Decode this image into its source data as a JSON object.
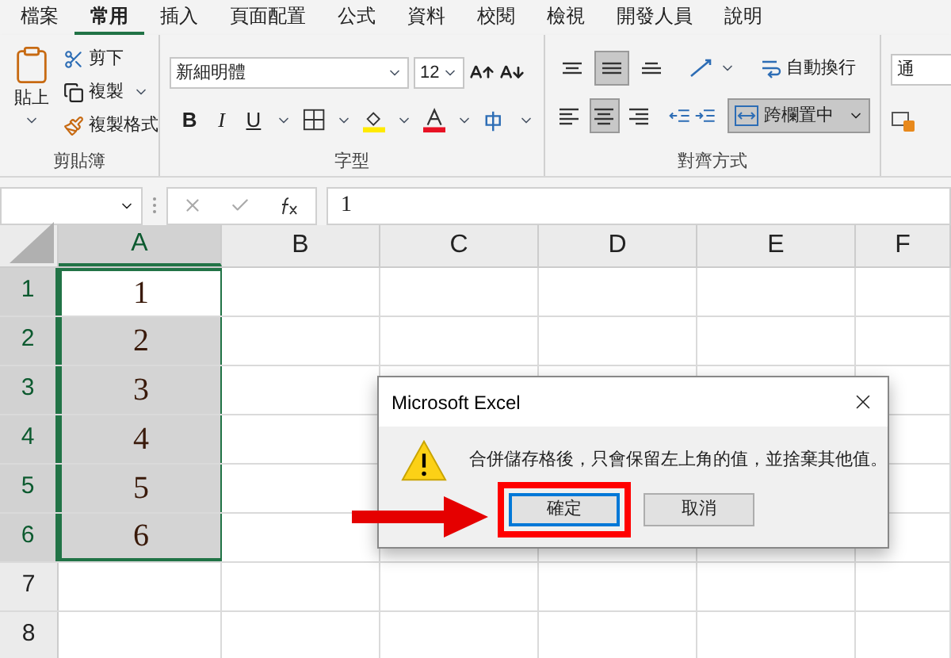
{
  "ribbon_tabs": [
    {
      "label": "檔案",
      "selected": false
    },
    {
      "label": "常用",
      "selected": true
    },
    {
      "label": "插入",
      "selected": false
    },
    {
      "label": "頁面配置",
      "selected": false
    },
    {
      "label": "公式",
      "selected": false
    },
    {
      "label": "資料",
      "selected": false
    },
    {
      "label": "校閱",
      "selected": false
    },
    {
      "label": "檢視",
      "selected": false
    },
    {
      "label": "開發人員",
      "selected": false
    },
    {
      "label": "說明",
      "selected": false
    }
  ],
  "clipboard": {
    "paste": "貼上",
    "cut": "剪下",
    "copy": "複製",
    "format_painter": "複製格式",
    "label": "剪貼簿"
  },
  "font": {
    "name": "新細明體",
    "size": "12",
    "bold": "B",
    "italic": "I",
    "underline": "U",
    "label": "字型"
  },
  "alignment": {
    "vertical": [
      {
        "kind": "top",
        "selected": false
      },
      {
        "kind": "middle",
        "selected": true
      },
      {
        "kind": "bottom",
        "selected": false
      }
    ],
    "horizontal": [
      {
        "kind": "left",
        "selected": false
      },
      {
        "kind": "center",
        "selected": true
      },
      {
        "kind": "right",
        "selected": false
      }
    ],
    "wrap_text": "自動換行",
    "merge_center": {
      "label": "跨欄置中",
      "selected": true
    },
    "label": "對齊方式"
  },
  "number": {
    "format": "通"
  },
  "formula_bar": {
    "value": "1"
  },
  "sheet": {
    "columns": [
      {
        "label": "A",
        "selected": true
      },
      {
        "label": "B",
        "selected": false
      },
      {
        "label": "C",
        "selected": false
      },
      {
        "label": "D",
        "selected": false
      },
      {
        "label": "E",
        "selected": false
      },
      {
        "label": "F",
        "selected": false
      }
    ],
    "rows": [
      {
        "label": "1",
        "selected": true,
        "active": true,
        "a": "1"
      },
      {
        "label": "2",
        "selected": true,
        "active": false,
        "a": "2"
      },
      {
        "label": "3",
        "selected": true,
        "active": false,
        "a": "3"
      },
      {
        "label": "4",
        "selected": true,
        "active": false,
        "a": "4"
      },
      {
        "label": "5",
        "selected": true,
        "active": false,
        "a": "5"
      },
      {
        "label": "6",
        "selected": true,
        "active": false,
        "a": "6"
      },
      {
        "label": "7",
        "selected": false,
        "active": false
      },
      {
        "label": "8",
        "selected": false,
        "active": false
      }
    ]
  },
  "dialog": {
    "title": "Microsoft Excel",
    "message": "合併儲存格後，只會保留左上角的值，並捨棄其他值。",
    "buttons": [
      {
        "label": "確定",
        "selected": true
      },
      {
        "label": "取消",
        "selected": false
      }
    ]
  }
}
